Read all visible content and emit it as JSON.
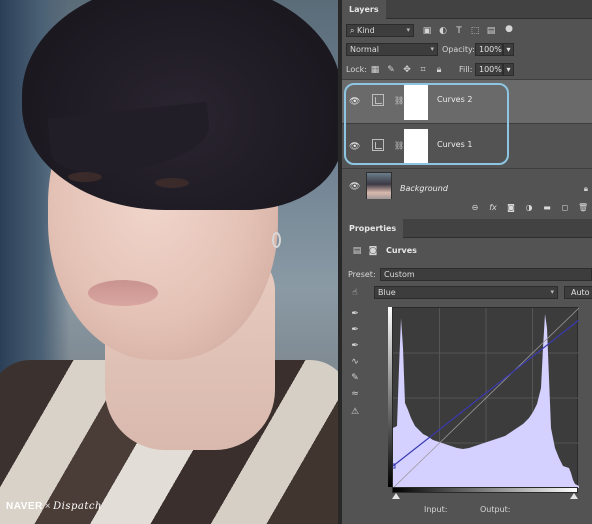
{
  "canvas": {
    "watermark_brand": "NAVER",
    "watermark_x": "×",
    "watermark_partner": "Dispatch"
  },
  "layers": {
    "tab_label": "Layers",
    "filter_kind": "Kind",
    "blend_mode": "Normal",
    "opacity_label": "Opacity:",
    "opacity_value": "100%",
    "lock_label": "Lock:",
    "fill_label": "Fill:",
    "fill_value": "100%",
    "items": [
      {
        "name": "Curves 2",
        "type": "curves-adjustment",
        "visible": true,
        "selected": true
      },
      {
        "name": "Curves 1",
        "type": "curves-adjustment",
        "visible": true,
        "selected": false
      },
      {
        "name": "Background",
        "type": "image",
        "visible": true,
        "selected": false,
        "locked": true
      }
    ],
    "footer_icons": [
      "link-icon",
      "fx-icon",
      "mask-icon",
      "adjustment-icon",
      "folder-icon",
      "new-layer-icon",
      "trash-icon"
    ]
  },
  "properties": {
    "tab_label": "Properties",
    "adjustment_title": "Curves",
    "preset_label": "Preset:",
    "preset_value": "Custom",
    "channel_value": "Blue",
    "auto_label": "Auto",
    "input_label": "Input:",
    "output_label": "Output:",
    "histogram_color": "#d4d0ff",
    "curve_color": "#3a3ab0"
  },
  "colors": {
    "panel_bg": "#535353",
    "selection_outline": "#8cc6e3",
    "selected_row": "#6a6a6a"
  }
}
